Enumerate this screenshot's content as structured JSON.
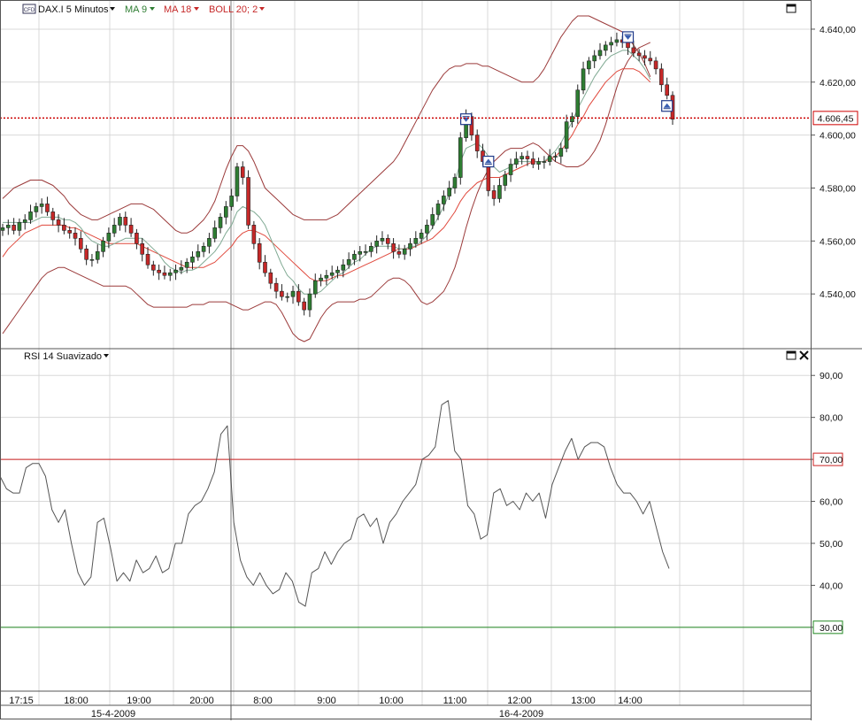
{
  "toolbar": {
    "cfd_badge": "CFD",
    "instrument": "DAX.I 5 Minutos",
    "ma9_label": "MA 9",
    "ma18_label": "MA 18",
    "boll_label": "BOLL 20; 2"
  },
  "rsi_panel": {
    "title": "RSI 14 Suavizado"
  },
  "colors": {
    "grid": "#d8d8d8",
    "candle_up": "#2e7d32",
    "candle_down": "#c62828",
    "ma9": "#7fa992",
    "ma18": "#e0483c",
    "bollinger": "#9b3a3a",
    "rsi_line": "#555555",
    "overbought": "#cc2222",
    "oversold": "#228822",
    "last_price": "#cc0000"
  },
  "chart_data": [
    {
      "type": "candlestick",
      "interval": "5 min",
      "ylim": [
        4520,
        4645
      ],
      "y_ticks": [
        "4.540,00",
        "4.560,00",
        "4.580,00",
        "4.600,00",
        "4.620,00",
        "4.640,00"
      ],
      "y_tick_values": [
        4540,
        4560,
        4580,
        4600,
        4620,
        4640
      ],
      "last_price_label": "4.606,45",
      "last_price": 4606.45,
      "x_tick_labels": [
        "17:15",
        "18:00",
        "19:00",
        "20:00",
        "8:00",
        "9:00",
        "10:00",
        "11:00",
        "12:00",
        "13:00",
        "14:00"
      ],
      "date_labels": [
        "15-4-2009",
        "16-4-2009"
      ],
      "session_break_after_bar": 21,
      "series": [
        {
          "name": "DAX.I 5 Minutos",
          "close": [
            4565,
            4566,
            4564,
            4567,
            4568,
            4571,
            4573,
            4574,
            4571,
            4568,
            4566,
            4564,
            4563,
            4561,
            4557,
            4553,
            4553,
            4556,
            4560,
            4563,
            4566,
            4569,
            4566,
            4563,
            4559,
            4555,
            4551,
            4549,
            4548,
            4547,
            4548,
            4549,
            4550,
            4552,
            4554,
            4556,
            4558,
            4561,
            4565,
            4569,
            4573,
            4577,
            4588,
            4584,
            4566,
            4559,
            4552,
            4548,
            4544,
            4541,
            4539,
            4539,
            4541,
            4537,
            4534,
            4540,
            4545,
            4546,
            4547,
            4548,
            4549,
            4551,
            4553,
            4555,
            4556,
            4556,
            4558,
            4560,
            4561,
            4559,
            4556,
            4555,
            4557,
            4559,
            4561,
            4563,
            4566,
            4570,
            4574,
            4577,
            4580,
            4584,
            4599,
            4607,
            4600,
            4594,
            4590,
            4579,
            4576,
            4581,
            4585,
            4589,
            4591,
            4592,
            4591,
            4589,
            4590,
            4590,
            4592,
            4592,
            4595,
            4605,
            4607,
            4617,
            4625,
            4628,
            4630,
            4632,
            4634,
            4635,
            4636,
            4635,
            4633,
            4631,
            4630,
            4629,
            4628,
            4625,
            4619,
            4615,
            4606
          ]
        },
        {
          "name": "MA 9",
          "values": [
            4567,
            4567,
            4567,
            4567,
            4567,
            4567,
            4568,
            4569,
            4569,
            4569,
            4569,
            4568,
            4568,
            4567,
            4565,
            4562,
            4560,
            4559,
            4558,
            4558,
            4559,
            4560,
            4561,
            4561,
            4561,
            4561,
            4559,
            4557,
            4555,
            4552,
            4550,
            4549,
            4548,
            4549,
            4549,
            4550,
            4552,
            4554,
            4556,
            4559,
            4563,
            4566,
            4571,
            4573,
            4572,
            4571,
            4569,
            4566,
            4561,
            4556,
            4551,
            4547,
            4545,
            4542,
            4540,
            4540,
            4540,
            4541,
            4543,
            4545,
            4547,
            4548,
            4550,
            4552,
            4553,
            4555,
            4557,
            4558,
            4558,
            4558,
            4558,
            4557,
            4557,
            4558,
            4558,
            4560,
            4562,
            4565,
            4569,
            4573,
            4578,
            4582,
            4590,
            4595,
            4596,
            4597,
            4595,
            4592,
            4588,
            4586,
            4587,
            4588,
            4590,
            4590,
            4590,
            4590,
            4590,
            4590,
            4592,
            4594,
            4597,
            4601,
            4605,
            4610,
            4614,
            4618,
            4622,
            4625,
            4628,
            4630,
            4631,
            4632,
            4632,
            4630,
            4628,
            4625,
            4621
          ]
        },
        {
          "name": "MA 18",
          "values": [
            4554,
            4557,
            4559,
            4561,
            4563,
            4564,
            4565,
            4566,
            4566,
            4566,
            4566,
            4566,
            4565,
            4565,
            4564,
            4563,
            4562,
            4561,
            4560,
            4559,
            4559,
            4559,
            4559,
            4559,
            4559,
            4558,
            4557,
            4556,
            4555,
            4554,
            4553,
            4552,
            4551,
            4550,
            4550,
            4550,
            4550,
            4551,
            4552,
            4554,
            4556,
            4558,
            4561,
            4563,
            4564,
            4564,
            4563,
            4562,
            4560,
            4558,
            4556,
            4554,
            4552,
            4550,
            4548,
            4546,
            4545,
            4545,
            4545,
            4546,
            4547,
            4547,
            4548,
            4549,
            4550,
            4551,
            4552,
            4553,
            4554,
            4555,
            4556,
            4557,
            4557,
            4557,
            4558,
            4559,
            4560,
            4561,
            4563,
            4565,
            4568,
            4571,
            4575,
            4578,
            4580,
            4582,
            4583,
            4584,
            4584,
            4584,
            4585,
            4586,
            4587,
            4588,
            4589,
            4590,
            4590,
            4590,
            4591,
            4592,
            4594,
            4597,
            4600,
            4604,
            4607,
            4611,
            4614,
            4617,
            4620,
            4622,
            4624,
            4625,
            4625,
            4625,
            4624,
            4622,
            4620
          ]
        },
        {
          "name": "BOLL 20; 2 upper",
          "values": [
            4576,
            4578,
            4580,
            4581,
            4582,
            4583,
            4583,
            4583,
            4582,
            4581,
            4579,
            4577,
            4574,
            4572,
            4570,
            4569,
            4568,
            4568,
            4569,
            4570,
            4571,
            4572,
            4573,
            4574,
            4574,
            4574,
            4573,
            4572,
            4570,
            4568,
            4566,
            4564,
            4563,
            4563,
            4564,
            4566,
            4568,
            4571,
            4575,
            4581,
            4587,
            4592,
            4596,
            4596,
            4594,
            4590,
            4585,
            4580,
            4578,
            4576,
            4574,
            4572,
            4570,
            4569,
            4568,
            4568,
            4568,
            4568,
            4568,
            4569,
            4570,
            4572,
            4574,
            4576,
            4578,
            4580,
            4582,
            4584,
            4586,
            4588,
            4590,
            4593,
            4597,
            4601,
            4605,
            4609,
            4613,
            4617,
            4620,
            4623,
            4625,
            4626,
            4626,
            4627,
            4627,
            4627,
            4626,
            4626,
            4625,
            4624,
            4623,
            4622,
            4621,
            4620,
            4620,
            4620,
            4622,
            4625,
            4629,
            4633,
            4637,
            4640,
            4643,
            4645,
            4645,
            4645,
            4644,
            4643,
            4642,
            4641,
            4640,
            4639,
            4637,
            4634,
            4631,
            4627,
            4622
          ]
        },
        {
          "name": "BOLL 20; 2 lower",
          "values": [
            4525,
            4528,
            4531,
            4534,
            4537,
            4540,
            4543,
            4546,
            4548,
            4549,
            4550,
            4550,
            4549,
            4548,
            4547,
            4546,
            4545,
            4544,
            4543,
            4543,
            4543,
            4543,
            4543,
            4542,
            4540,
            4538,
            4536,
            4535,
            4535,
            4535,
            4535,
            4535,
            4535,
            4535,
            4536,
            4536,
            4536,
            4537,
            4537,
            4537,
            4537,
            4536,
            4535,
            4534,
            4534,
            4535,
            4536,
            4537,
            4537,
            4536,
            4533,
            4529,
            4525,
            4523,
            4522,
            4523,
            4527,
            4531,
            4534,
            4536,
            4537,
            4537,
            4537,
            4537,
            4538,
            4538,
            4539,
            4541,
            4543,
            4545,
            4546,
            4546,
            4545,
            4543,
            4540,
            4537,
            4536,
            4537,
            4539,
            4541,
            4545,
            4550,
            4557,
            4565,
            4572,
            4578,
            4583,
            4587,
            4590,
            4592,
            4594,
            4595,
            4595,
            4595,
            4596,
            4597,
            4596,
            4594,
            4592,
            4590,
            4589,
            4588,
            4588,
            4588,
            4589,
            4591,
            4594,
            4598,
            4604,
            4611,
            4618,
            4624,
            4628,
            4631,
            4633,
            4634,
            4635
          ]
        }
      ],
      "signal_markers": [
        {
          "bar": 83,
          "direction": "down",
          "price": 4606
        },
        {
          "bar": 87,
          "direction": "up",
          "price": 4590
        },
        {
          "bar": 112,
          "direction": "down",
          "price": 4637
        },
        {
          "bar": 119,
          "direction": "up",
          "price": 4611
        }
      ]
    },
    {
      "type": "line",
      "title": "RSI 14 Suavizado",
      "ylim": [
        15,
        93
      ],
      "y_ticks": [
        "30,00",
        "40,00",
        "50,00",
        "60,00",
        "70,00",
        "80,00",
        "90,00"
      ],
      "y_tick_values": [
        30,
        40,
        50,
        60,
        70,
        80,
        90
      ],
      "overbought": 70,
      "overbought_label": "70,00",
      "oversold": 30,
      "oversold_label": "30,00",
      "series": [
        {
          "name": "RSI 14 Suavizado",
          "values": [
            66,
            63,
            62,
            62,
            68,
            69,
            69,
            66,
            58,
            55,
            58,
            50,
            43,
            40,
            42,
            55,
            56,
            49,
            41,
            43,
            41,
            46,
            43,
            44,
            47,
            43,
            44,
            50,
            50,
            57,
            59,
            60,
            63,
            67,
            76,
            78,
            55,
            46,
            42,
            40,
            43,
            40,
            38,
            39,
            43,
            41,
            36,
            35,
            43,
            44,
            48,
            45,
            48,
            50,
            51,
            56,
            57,
            54,
            56,
            50,
            55,
            57,
            60,
            62,
            64,
            70,
            71,
            73,
            83,
            84,
            72,
            70,
            59,
            57,
            51,
            52,
            62,
            63,
            59,
            60,
            58,
            62,
            60,
            62,
            56,
            64,
            68,
            72,
            75,
            70,
            73,
            74,
            74,
            73,
            68,
            64,
            62,
            62,
            60,
            57,
            60,
            54,
            48,
            44
          ]
        }
      ]
    }
  ]
}
